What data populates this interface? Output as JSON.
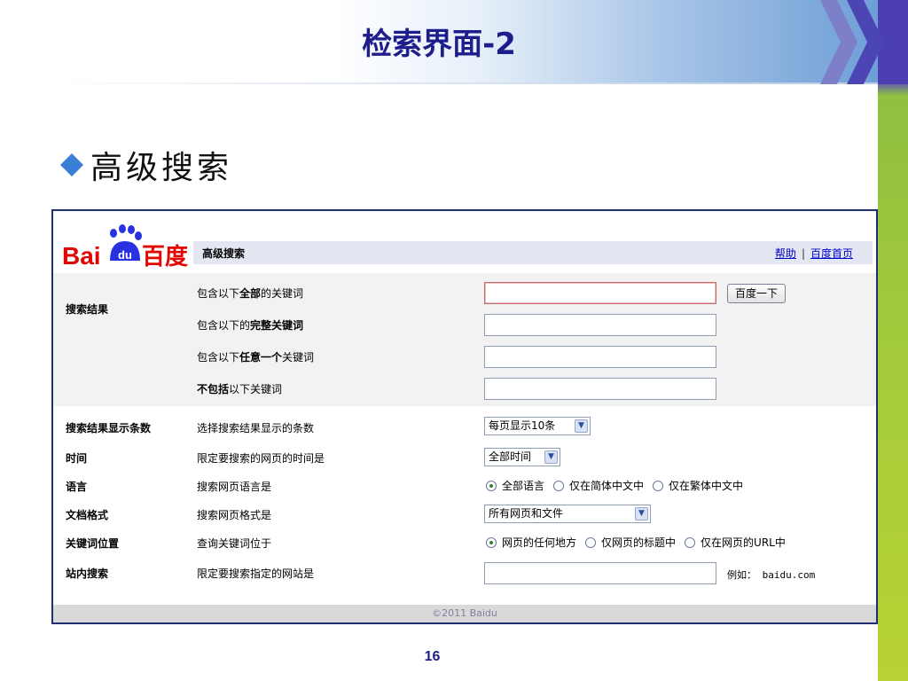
{
  "slide": {
    "title": "检索界面-2",
    "bullet": "高级搜索",
    "page_number": "16",
    "colors": {
      "title": "#1d1d8c",
      "bullet": "#3a7fd6",
      "accent_bar": "#a8cc3a"
    }
  },
  "baidu": {
    "logo_text_latin": "Bai",
    "logo_text_badge": "du",
    "logo_text_cn": "百度",
    "header_title": "高级搜索",
    "help_link": "帮助",
    "separator": "|",
    "home_link": "百度首页",
    "search_result_label": "搜索结果",
    "keyword_rows": [
      {
        "pre": "包含以下",
        "bold": "全部",
        "post": "的关键词"
      },
      {
        "pre": "包含以下的",
        "bold": "完整关键词",
        "post": ""
      },
      {
        "pre": "包含以下",
        "bold": "任意一个",
        "post": "关键词"
      },
      {
        "pre": "",
        "bold": "不包括",
        "post": "以下关键词"
      }
    ],
    "search_button": "百度一下",
    "settings": {
      "count": {
        "label": "搜索结果显示条数",
        "desc": "选择搜索结果显示的条数",
        "value": "每页显示10条"
      },
      "time": {
        "label": "时间",
        "desc": "限定要搜索的网页的时间是",
        "value": "全部时间"
      },
      "language": {
        "label": "语言",
        "desc": "搜索网页语言是",
        "options": [
          "全部语言",
          "仅在简体中文中",
          "仅在繁体中文中"
        ],
        "selected": "全部语言"
      },
      "format": {
        "label": "文档格式",
        "desc": "搜索网页格式是",
        "value": "所有网页和文件"
      },
      "position": {
        "label": "关键词位置",
        "desc": "查询关键词位于",
        "options": [
          "网页的任何地方",
          "仅网页的标题中",
          "仅在网页的URL中"
        ],
        "selected": "网页的任何地方"
      },
      "site": {
        "label": "站内搜索",
        "desc": "限定要搜索指定的网站是",
        "example": "例如： baidu.com"
      }
    },
    "footer": "©2011 Baidu"
  }
}
